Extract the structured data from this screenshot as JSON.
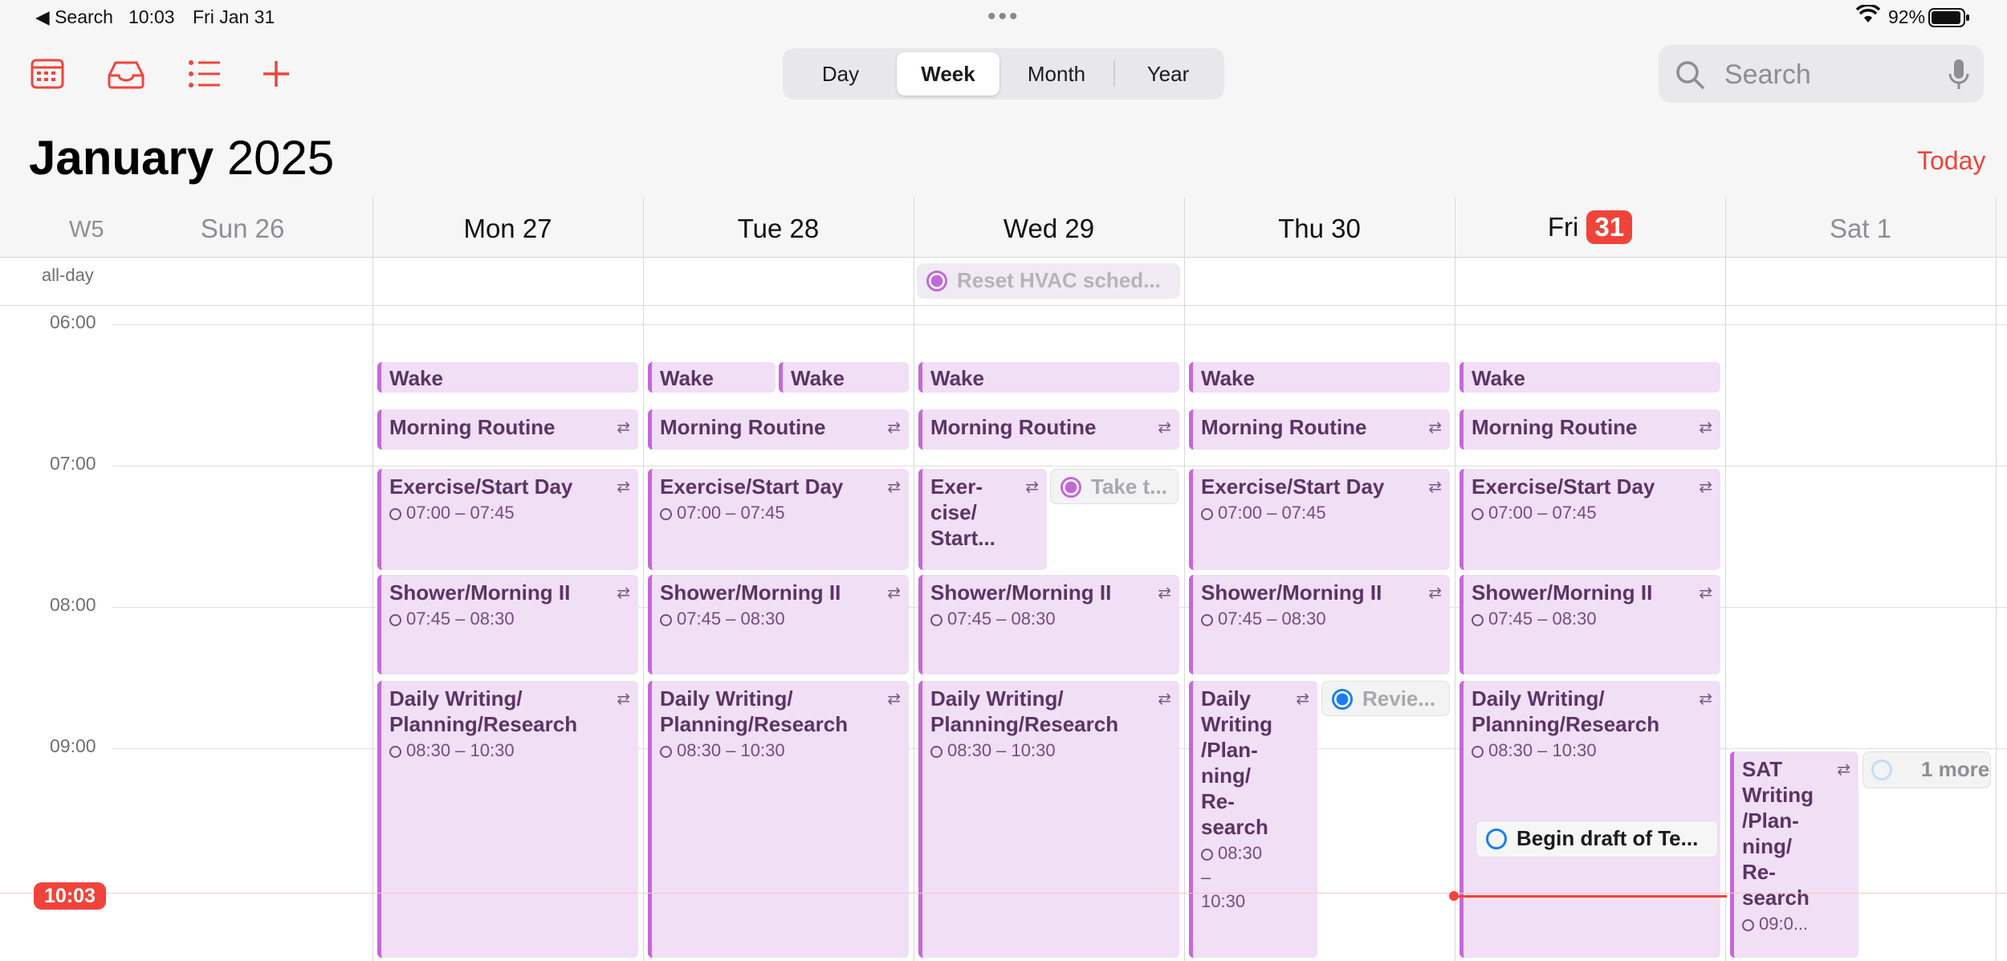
{
  "status": {
    "back": "◀ Search",
    "time": "10:03",
    "date": "Fri Jan 31",
    "battery": "92%"
  },
  "toolbar": {
    "icons": [
      "calendar-icon",
      "inbox-icon",
      "list-icon",
      "plus-icon"
    ],
    "views": [
      "Day",
      "Week",
      "Month",
      "Year"
    ],
    "active_view": "Week",
    "search_placeholder": "Search",
    "today": "Today"
  },
  "title": {
    "month": "January",
    "year": "2025"
  },
  "week": {
    "label": "W5",
    "days": [
      "Sun 26",
      "Mon 27",
      "Tue 28",
      "Wed 29",
      "Thu 30",
      "Fri",
      "Sat 1"
    ],
    "today_num": "31"
  },
  "allday": {
    "label": "all-day",
    "task": "Reset HVAC sched..."
  },
  "hours": [
    "06:00",
    "07:00",
    "08:00",
    "09:00"
  ],
  "now": "10:03",
  "events": {
    "wake": "Wake",
    "morning": "Morning Routine",
    "exercise": "Exercise/Start Day",
    "exercise_time": "07:00 – 07:45",
    "exercise_wed": "Exer-\ncise/\nStart...",
    "shower": "Shower/Morning II",
    "shower_time": "07:45 – 08:30",
    "writing": "Daily Writing/\nPlanning/Research",
    "writing_time": "08:30 – 10:30",
    "writing_thu": "Daily\nWriting\n/Plan-\nning/\nRe-\nsearch",
    "writing_thu_time": "08:30\n–\n10:30",
    "sat_writing": "SAT\nWriting\n/Plan-\nning/\nRe-\nsearch",
    "sat_time": "09:0..."
  },
  "tasks": {
    "wed": "Take t...",
    "thu": "Revie...",
    "fri": "Begin draft of Te...",
    "sat_more": "1 more"
  }
}
